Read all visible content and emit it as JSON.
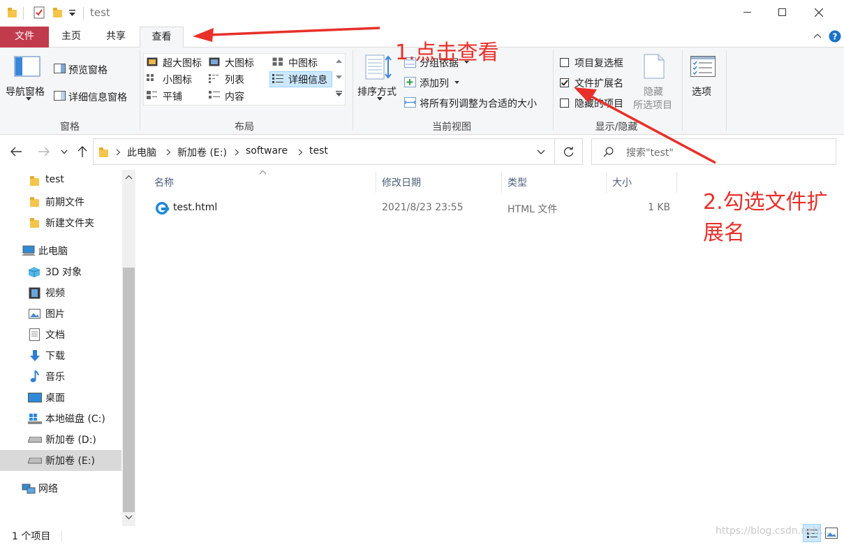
{
  "window": {
    "title": "test"
  },
  "ribbon_tabs": [
    {
      "label": "文件"
    },
    {
      "label": "主页"
    },
    {
      "label": "共享"
    },
    {
      "label": "查看"
    }
  ],
  "ribbon": {
    "panes": {
      "label": "窗格",
      "nav_pane": "导航窗格",
      "preview_pane": "预览窗格",
      "details_pane": "详细信息窗格"
    },
    "layout": {
      "label": "布局",
      "items": [
        "超大图标",
        "大图标",
        "中图标",
        "小图标",
        "列表",
        "详细信息",
        "平铺",
        "内容"
      ]
    },
    "current_view": {
      "label": "当前视图",
      "sort_by": "排序方式",
      "group_by": "分组依据",
      "add_column": "添加列",
      "size_all_columns": "将所有列调整为合适的大小"
    },
    "show_hide": {
      "label": "显示/隐藏",
      "item_checkboxes": "项目复选框",
      "file_extensions": "文件扩展名",
      "hidden_items": "隐藏的项目",
      "hide_selected_line1": "隐藏",
      "hide_selected_line2": "所选项目"
    },
    "options": "选项"
  },
  "address": {
    "crumbs": [
      "此电脑",
      "新加卷 (E:)",
      "software",
      "test"
    ],
    "search_placeholder": "搜索\"test\""
  },
  "nav": {
    "quick": [
      "test",
      "前期文件",
      "新建文件夹"
    ],
    "this_pc": "此电脑",
    "pc_items": [
      "3D 对象",
      "视频",
      "图片",
      "文档",
      "下载",
      "音乐",
      "桌面",
      "本地磁盘 (C:)",
      "新加卷 (D:)",
      "新加卷 (E:)"
    ],
    "network": "网络"
  },
  "columns": [
    "名称",
    "修改日期",
    "类型",
    "大小"
  ],
  "files": [
    {
      "name": "test.html",
      "modified": "2021/8/23 23:55",
      "type": "HTML 文件",
      "size": "1 KB"
    }
  ],
  "status": {
    "count": "1 个项目"
  },
  "annotations": {
    "step1": "1.点击查看",
    "step2_line1": "2.勾选文件扩",
    "step2_line2": "展名",
    "watermark": "https://blog.csdn.net/..."
  },
  "colors": {
    "file_tab": "#c23b4d",
    "annotation": "#e8302a",
    "selected_nav": "#cce8ff"
  }
}
